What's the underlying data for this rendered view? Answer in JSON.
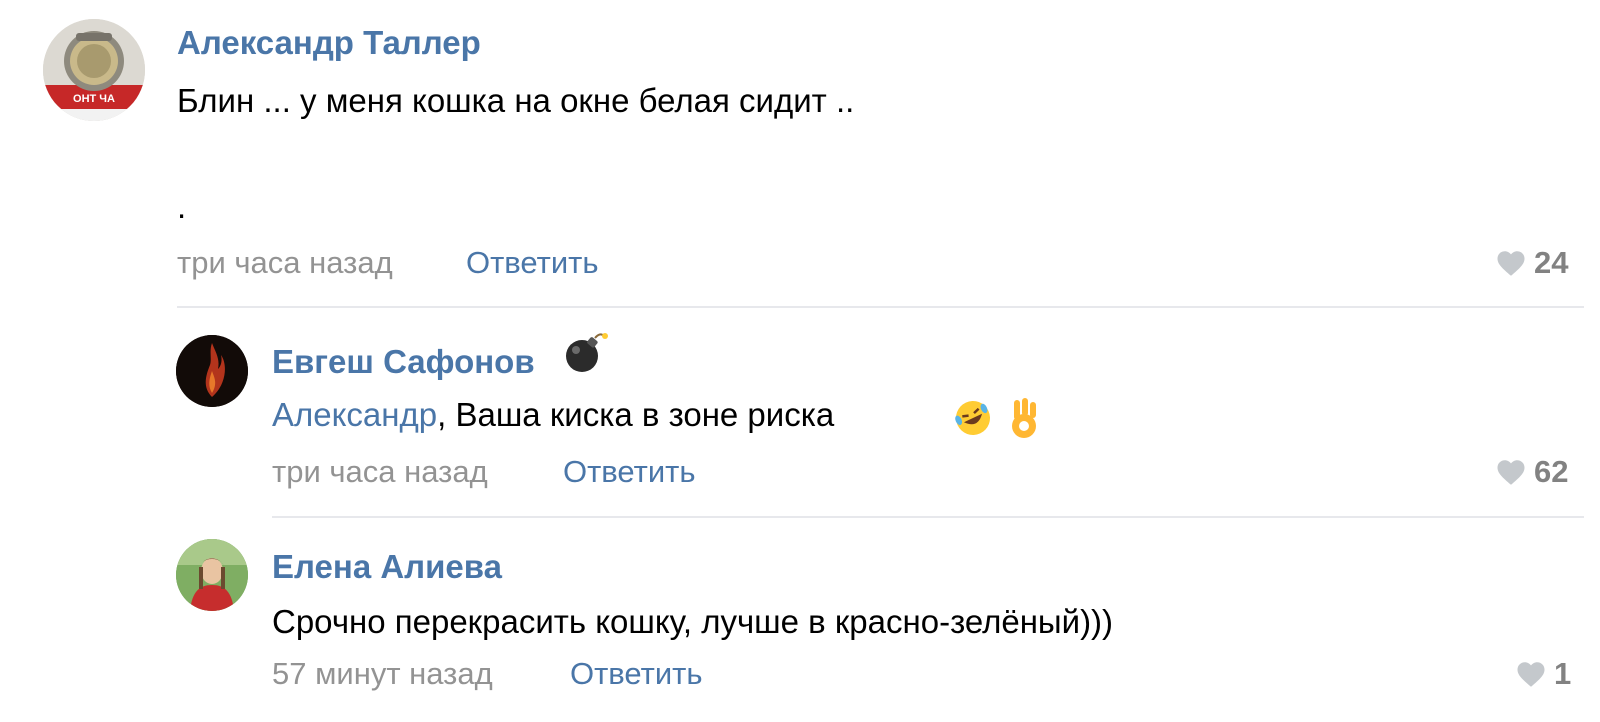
{
  "comments": [
    {
      "author": "Александр Таллер",
      "text_line1": "Блин ... у меня кошка на окне белая сидит ..",
      "text_line2": ".",
      "time": "три часа назад",
      "reply_label": "Ответить",
      "likes": "24",
      "avatar_text": "ОНТ ЧА"
    },
    {
      "author": "Евгеш Сафонов",
      "badge_icon": "bomb-icon",
      "mention": "Александр",
      "text": ", Ваша киска в зоне риска",
      "emojis": [
        "rofl-emoji",
        "ok-hand-emoji"
      ],
      "time": "три часа назад",
      "reply_label": "Ответить",
      "likes": "62"
    },
    {
      "author": "Елена Алиева",
      "text": "Срочно перекрасить кошку, лучше в красно-зелёный)))",
      "time": "57 минут назад",
      "reply_label": "Ответить",
      "likes": "1"
    }
  ],
  "colors": {
    "link": "#4a76a8",
    "muted": "#939393",
    "like_heart": "#c4c8cc",
    "divider": "#e7e8ec"
  }
}
